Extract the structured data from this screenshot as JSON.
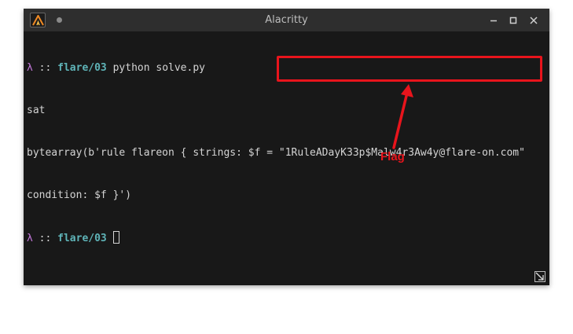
{
  "window": {
    "title": "Alacritty",
    "icons": {
      "app": "alacritty-logo-icon",
      "minimize": "minimize-icon",
      "maximize": "maximize-icon",
      "close": "close-icon",
      "resize": "resize-grip-icon"
    }
  },
  "terminal": {
    "prompt_symbol": "λ",
    "prompt_sep": " :: ",
    "cwd": "flare/03",
    "lines": {
      "cmd": " python solve.py",
      "out1": "sat",
      "out2": "bytearray(b'rule flareon { strings: $f = \"1RuleADayK33p$Malw4r3Aw4y@flare-on.com\"",
      "out3": "condition: $f }')"
    }
  },
  "annotation": {
    "label": "Flag",
    "color": "#e8141c"
  },
  "colors": {
    "terminal_bg": "#181818",
    "titlebar_bg": "#2e2e2e",
    "prompt_lambda": "#c678dd",
    "prompt_dir": "#5fb4b8"
  }
}
